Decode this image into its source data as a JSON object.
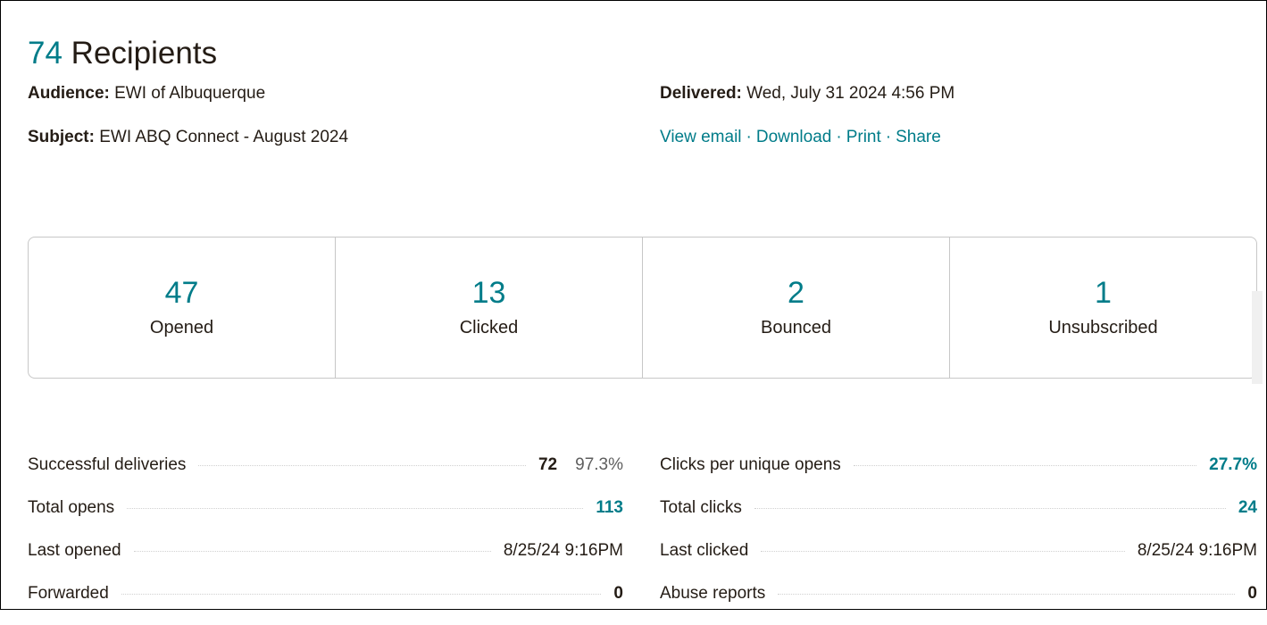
{
  "header": {
    "recipient_count": "74",
    "recipient_label": " Recipients"
  },
  "meta": {
    "audience_label": "Audience:",
    "audience_value": " EWI of Albuquerque",
    "subject_label": "Subject:",
    "subject_value": " EWI ABQ Connect - August 2024",
    "delivered_label": "Delivered:",
    "delivered_value": " Wed, July 31 2024 4:56 PM"
  },
  "links": {
    "view_email": "View email",
    "download": "Download",
    "print": "Print",
    "share": "Share",
    "separator": "·"
  },
  "stats": [
    {
      "value": "47",
      "label": "Opened"
    },
    {
      "value": "13",
      "label": "Clicked"
    },
    {
      "value": "2",
      "label": "Bounced"
    },
    {
      "value": "1",
      "label": "Unsubscribed"
    }
  ],
  "metrics_left": [
    {
      "name": "Successful deliveries",
      "value": "72",
      "percent": "97.3%"
    },
    {
      "name": "Total opens",
      "value": "113"
    },
    {
      "name": "Last opened",
      "value": "8/25/24 9:16PM"
    },
    {
      "name": "Forwarded",
      "value": "0"
    }
  ],
  "metrics_right": [
    {
      "name": "Clicks per unique opens",
      "value": "27.7%"
    },
    {
      "name": "Total clicks",
      "value": "24"
    },
    {
      "name": "Last clicked",
      "value": "8/25/24 9:16PM"
    },
    {
      "name": "Abuse reports",
      "value": "0"
    }
  ],
  "colors": {
    "accent": "#007c89",
    "text": "#241c15",
    "border": "#c7c7c7"
  }
}
